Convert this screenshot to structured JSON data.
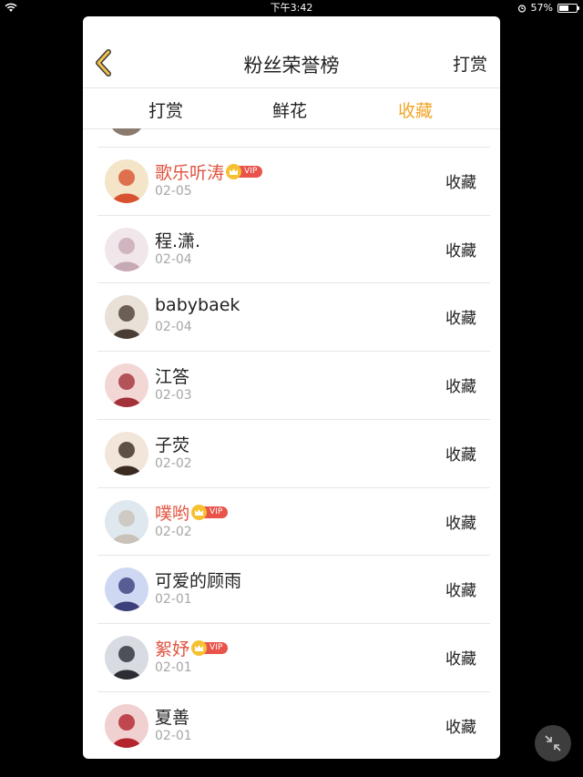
{
  "status_bar": {
    "time": "下午3:42",
    "battery": "57%",
    "battery_level": 0.57
  },
  "header": {
    "title": "粉丝荣誉榜",
    "right_action": "打赏"
  },
  "tabs": [
    {
      "label": "打赏",
      "active": false
    },
    {
      "label": "鲜花",
      "active": false
    },
    {
      "label": "收藏",
      "active": true
    }
  ],
  "colors": {
    "active_tab": "#f0a62a",
    "vip_name": "#e0533f",
    "vip_badge": "#e8534a",
    "crown": "#f5c132"
  },
  "vip_label": "VIP",
  "list": [
    {
      "name": "歌乐听涛",
      "date": "02-05",
      "action": "收藏",
      "vip": true
    },
    {
      "name": "程.潇.",
      "date": "02-04",
      "action": "收藏",
      "vip": false
    },
    {
      "name": "babybaek",
      "date": "02-04",
      "action": "收藏",
      "vip": false
    },
    {
      "name": "江答",
      "date": "02-03",
      "action": "收藏",
      "vip": false
    },
    {
      "name": "子荧",
      "date": "02-02",
      "action": "收藏",
      "vip": false
    },
    {
      "name": "噗哟",
      "date": "02-02",
      "action": "收藏",
      "vip": true
    },
    {
      "name": "可爱的顾雨",
      "date": "02-01",
      "action": "收藏",
      "vip": false
    },
    {
      "name": "絮妤",
      "date": "02-01",
      "action": "收藏",
      "vip": true
    },
    {
      "name": "夏善",
      "date": "02-01",
      "action": "收藏",
      "vip": false
    }
  ]
}
